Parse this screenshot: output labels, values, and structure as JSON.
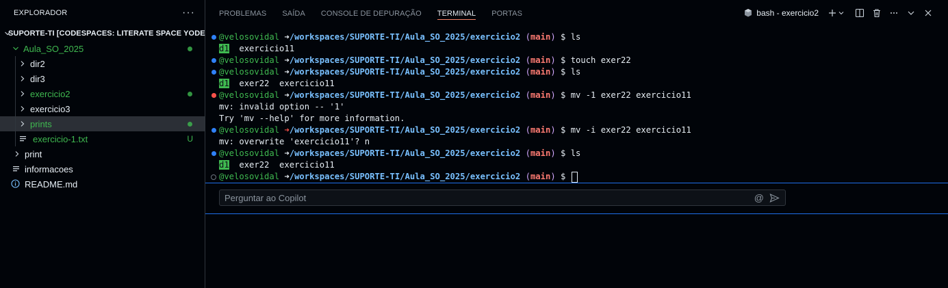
{
  "explorer": {
    "title": "EXPLORADOR",
    "more_label": "···",
    "root_label": "SUPORTE-TI [CODESPACES: LITERATE SPACE YODEL]",
    "items": [
      {
        "label": "Aula_SO_2025",
        "kind": "folder-open",
        "status": "dot"
      },
      {
        "label": "dir2",
        "kind": "folder"
      },
      {
        "label": "dir3",
        "kind": "folder"
      },
      {
        "label": "exercicio2",
        "kind": "folder",
        "status": "dot"
      },
      {
        "label": "exercicio3",
        "kind": "folder"
      },
      {
        "label": "prints",
        "kind": "folder",
        "status": "dot",
        "selected": true
      },
      {
        "label": "exercicio-1.txt",
        "kind": "file",
        "status": "U"
      },
      {
        "label": "print",
        "kind": "folder"
      },
      {
        "label": "informacoes",
        "kind": "file"
      },
      {
        "label": "README.md",
        "kind": "info-file"
      }
    ]
  },
  "panel": {
    "tabs": [
      "PROBLEMAS",
      "SAÍDA",
      "CONSOLE DE DEPURAÇÃO",
      "TERMINAL",
      "PORTAS"
    ],
    "active_tab": "TERMINAL",
    "terminal_name": "bash - exercicio2"
  },
  "terminal": {
    "user": "@velosovidal",
    "path": "/workspaces/SUPORTE-TI/Aula_SO_2025/exercicio2",
    "branch": "main",
    "lines": [
      {
        "type": "prompt",
        "status": "ok",
        "cmd": "ls"
      },
      {
        "type": "ls",
        "dir": "d1",
        "rest": "  exercicio11"
      },
      {
        "type": "prompt",
        "status": "ok",
        "cmd": "touch exer22"
      },
      {
        "type": "prompt",
        "status": "ok",
        "cmd": "ls"
      },
      {
        "type": "ls",
        "dir": "d1",
        "rest": "  exer22  exercicio11"
      },
      {
        "type": "prompt",
        "status": "err",
        "cmd": "mv -1 exer22 exercicio11"
      },
      {
        "type": "out",
        "text": "mv: invalid option -- '1'"
      },
      {
        "type": "out",
        "text": "Try 'mv --help' for more information."
      },
      {
        "type": "prompt",
        "status": "ok",
        "arrow": "err",
        "cmd": "mv -i exer22 exercicio11"
      },
      {
        "type": "out",
        "text": "mv: overwrite 'exercicio11'? n"
      },
      {
        "type": "prompt",
        "status": "ok",
        "cmd": "ls"
      },
      {
        "type": "ls",
        "dir": "d1",
        "rest": "  exer22  exercicio11"
      },
      {
        "type": "prompt",
        "status": "pending",
        "cmd": "",
        "cursor": true
      }
    ]
  },
  "copilot": {
    "placeholder": "Perguntar ao Copilot",
    "mention_icon": "@",
    "send_icon": "send-icon"
  },
  "colors": {
    "accent": "#f78166",
    "focus_border": "#1f6feb",
    "user_green": "#3fb950",
    "path_blue": "#79c0ff",
    "branch_red": "#ff7b72"
  }
}
